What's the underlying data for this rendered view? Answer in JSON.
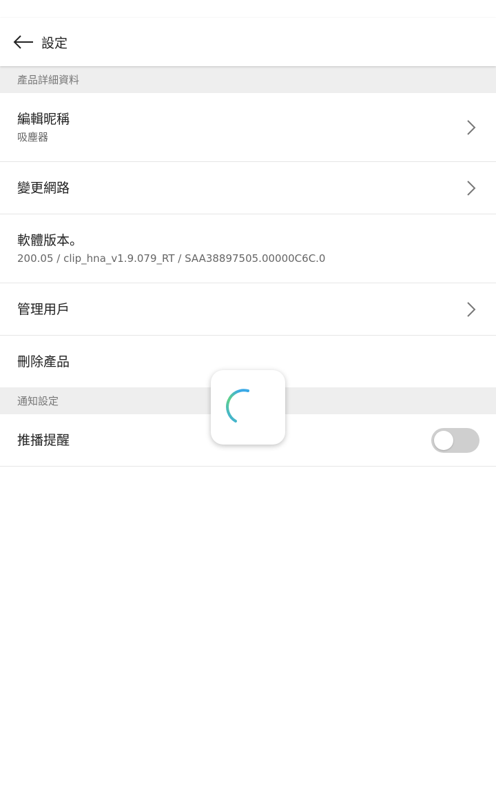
{
  "header": {
    "title": "設定",
    "back_icon": "arrow-left-icon"
  },
  "sections": {
    "product_details": {
      "header": "產品詳細資料",
      "edit_nickname": {
        "title": "編輯昵稱",
        "value": "吸塵器"
      },
      "change_network": {
        "title": "變更網路"
      },
      "software_version": {
        "title": "軟體版本。",
        "value": "200.05 / clip_hna_v1.9.079_RT / SAA38897505.00000C6C.0"
      },
      "manage_users": {
        "title": "管理用戶"
      },
      "delete_product": {
        "title": "刪除產品"
      }
    },
    "notification_settings": {
      "header": "通知設定",
      "push_reminder": {
        "title": "推播提醒",
        "enabled": false
      }
    }
  },
  "colors": {
    "section_bg": "#eeeeee",
    "toggle_off": "#cfcfcf",
    "spinner_start": "#5fd18a",
    "spinner_end": "#3aa9e6"
  }
}
